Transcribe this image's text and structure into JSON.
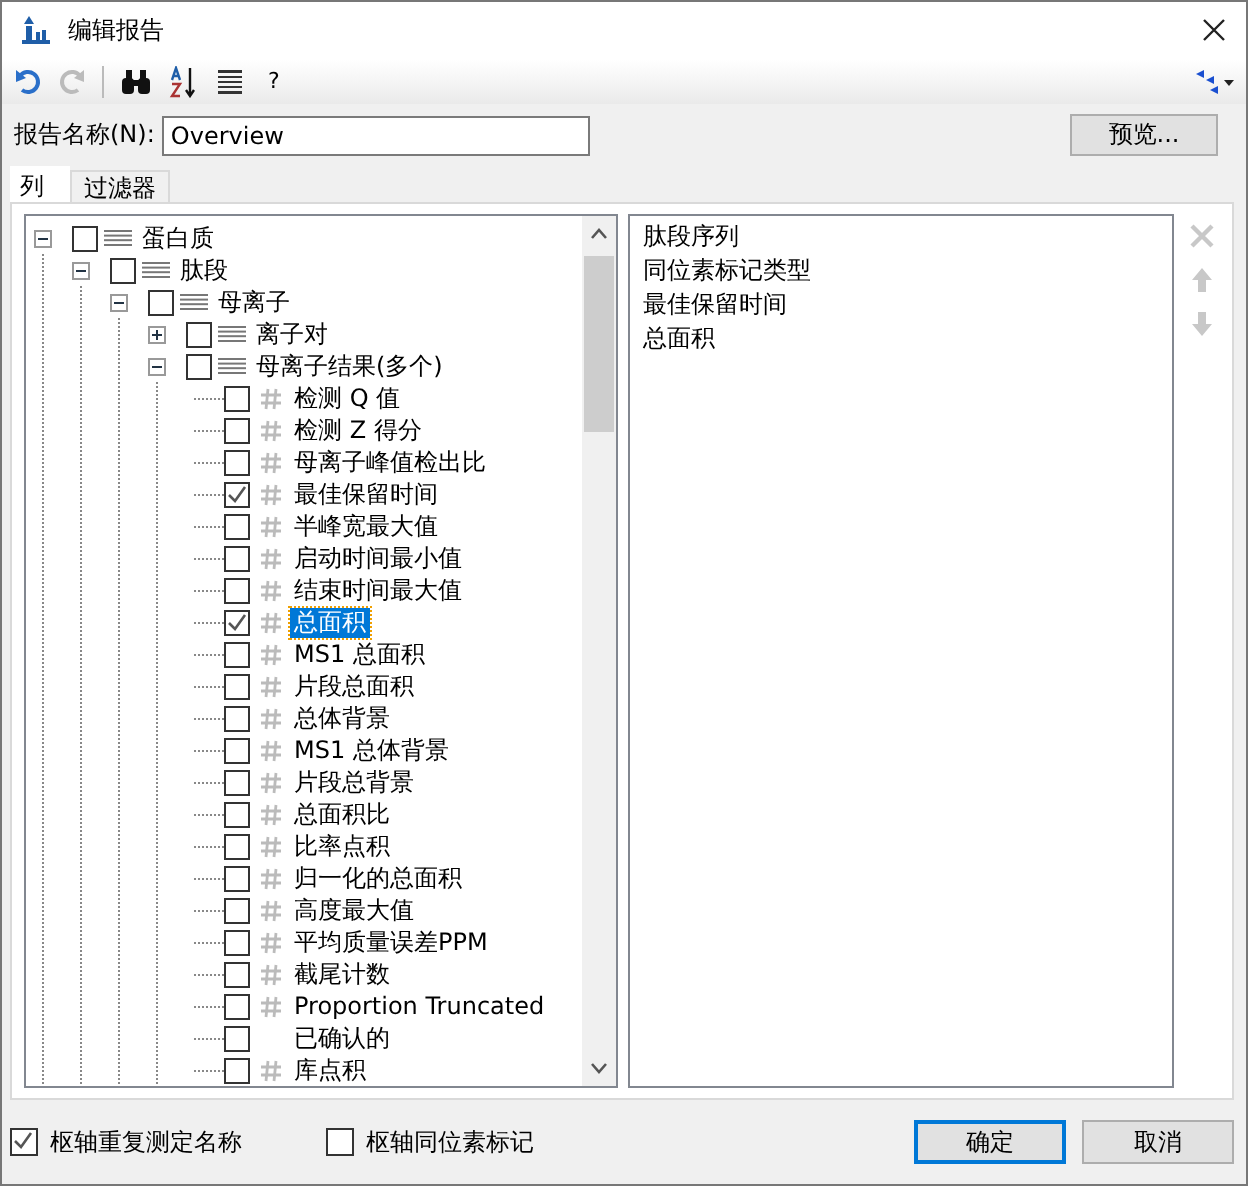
{
  "window": {
    "title": "编辑报告"
  },
  "toolbar": {
    "help": "?"
  },
  "report_name": {
    "label": "报告名称(N):",
    "value": "Overview"
  },
  "preview_button": "预览...",
  "tabs": [
    {
      "label": "列",
      "selected": true
    },
    {
      "label": "过滤器",
      "selected": false
    }
  ],
  "tree": [
    {
      "label": "蛋白质",
      "kind": "group",
      "expanded": true,
      "checked": false,
      "selected": false,
      "children": [
        {
          "label": "肽段",
          "kind": "group",
          "expanded": true,
          "checked": false,
          "selected": false,
          "children": [
            {
              "label": "母离子",
              "kind": "group",
              "expanded": true,
              "checked": false,
              "selected": false,
              "children": [
                {
                  "label": "离子对",
                  "kind": "group",
                  "expanded": false,
                  "checked": false,
                  "selected": false
                },
                {
                  "label": "母离子结果(多个)",
                  "kind": "group",
                  "expanded": true,
                  "checked": false,
                  "selected": false,
                  "children": [
                    {
                      "label": "检测 Q 值",
                      "kind": "number",
                      "checked": false,
                      "selected": false
                    },
                    {
                      "label": "检测 Z 得分",
                      "kind": "number",
                      "checked": false,
                      "selected": false
                    },
                    {
                      "label": "母离子峰值检出比",
                      "kind": "number",
                      "checked": false,
                      "selected": false
                    },
                    {
                      "label": "最佳保留时间",
                      "kind": "number",
                      "checked": true,
                      "selected": false
                    },
                    {
                      "label": "半峰宽最大值",
                      "kind": "number",
                      "checked": false,
                      "selected": false
                    },
                    {
                      "label": "启动时间最小值",
                      "kind": "number",
                      "checked": false,
                      "selected": false
                    },
                    {
                      "label": "结束时间最大值",
                      "kind": "number",
                      "checked": false,
                      "selected": false
                    },
                    {
                      "label": "总面积",
                      "kind": "number",
                      "checked": true,
                      "selected": true
                    },
                    {
                      "label": "MS1 总面积",
                      "kind": "number",
                      "checked": false,
                      "selected": false
                    },
                    {
                      "label": "片段总面积",
                      "kind": "number",
                      "checked": false,
                      "selected": false
                    },
                    {
                      "label": "总体背景",
                      "kind": "number",
                      "checked": false,
                      "selected": false
                    },
                    {
                      "label": "MS1 总体背景",
                      "kind": "number",
                      "checked": false,
                      "selected": false
                    },
                    {
                      "label": "片段总背景",
                      "kind": "number",
                      "checked": false,
                      "selected": false
                    },
                    {
                      "label": "总面积比",
                      "kind": "number",
                      "checked": false,
                      "selected": false
                    },
                    {
                      "label": "比率点积",
                      "kind": "number",
                      "checked": false,
                      "selected": false
                    },
                    {
                      "label": "归一化的总面积",
                      "kind": "number",
                      "checked": false,
                      "selected": false
                    },
                    {
                      "label": "高度最大值",
                      "kind": "number",
                      "checked": false,
                      "selected": false
                    },
                    {
                      "label": "平均质量误差PPM",
                      "kind": "number",
                      "checked": false,
                      "selected": false
                    },
                    {
                      "label": "截尾计数",
                      "kind": "number",
                      "checked": false,
                      "selected": false
                    },
                    {
                      "label": "Proportion Truncated",
                      "kind": "number",
                      "checked": false,
                      "selected": false
                    },
                    {
                      "label": "已确认的",
                      "kind": "bool",
                      "checked": false,
                      "selected": false
                    },
                    {
                      "label": "库点积",
                      "kind": "number",
                      "checked": false,
                      "selected": false
                    }
                  ]
                }
              ]
            }
          ]
        }
      ]
    }
  ],
  "columns_list": [
    "肽段序列",
    "同位素标记类型",
    "最佳保留时间",
    "总面积"
  ],
  "options": [
    {
      "label": "枢轴重复测定名称",
      "checked": true
    },
    {
      "label": "枢轴同位素标记",
      "checked": false
    }
  ],
  "buttons": [
    {
      "label": "确定",
      "default": true
    },
    {
      "label": "取消",
      "default": false
    }
  ]
}
